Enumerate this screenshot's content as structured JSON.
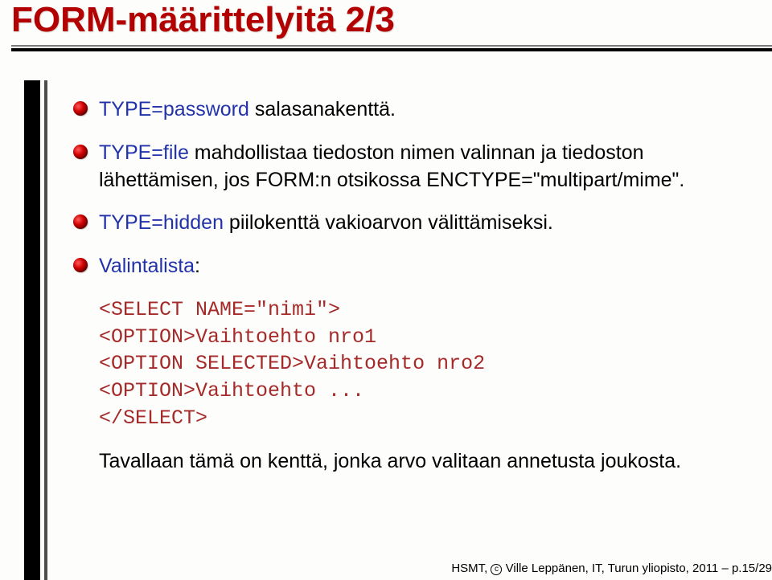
{
  "title": "FORM-määrittelyitä 2/3",
  "bullets": [
    {
      "term": "TYPE=password",
      "rest": " salasanakenttä."
    },
    {
      "term": "TYPE=file",
      "rest": " mahdollistaa tiedoston nimen valinnan ja tiedoston lähettämisen, jos FORM:n otsikossa ENCTYPE=\"multipart/mime\"."
    },
    {
      "term": "TYPE=hidden",
      "rest": " piilokenttä vakioarvon välittämiseksi."
    },
    {
      "term": "Valintalista",
      "rest": ""
    }
  ],
  "code": {
    "l1": "<SELECT NAME=\"nimi\">",
    "l2": "<OPTION>Vaihtoehto nro1",
    "l3": "<OPTION SELECTED>Vaihtoehto nro2",
    "l4": "<OPTION>Vaihtoehto ...",
    "l5": "</SELECT>"
  },
  "note": "Tavallaan tämä on kenttä, jonka arvo valitaan annetusta joukosta.",
  "footer": {
    "prefix": "HSMT, ",
    "copy_c": "c",
    "rest": " Ville Leppänen, IT, Turun yliopisto, 2011 – p.15/29"
  }
}
